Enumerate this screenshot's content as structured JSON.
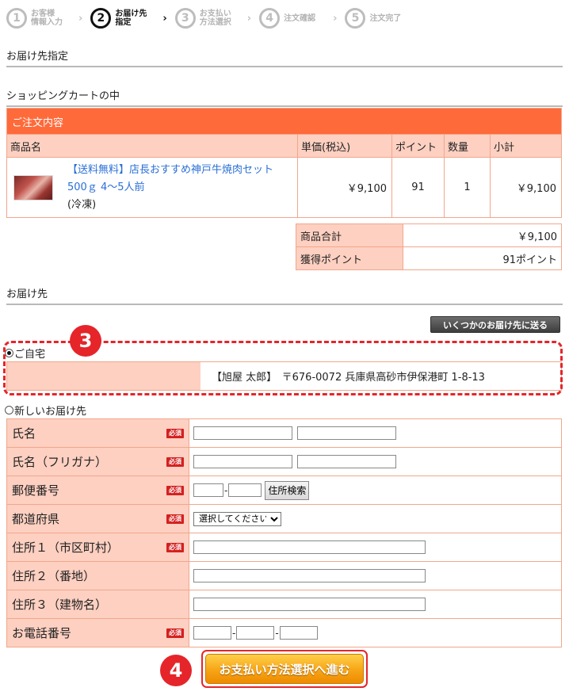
{
  "steps": [
    {
      "num": "1",
      "label": "お客様\n情報入力",
      "active": false
    },
    {
      "num": "2",
      "label": "お届け先\n指定",
      "active": true
    },
    {
      "num": "3",
      "label": "お支払い\n方法選択",
      "active": false
    },
    {
      "num": "4",
      "label": "注文確認",
      "active": false
    },
    {
      "num": "5",
      "label": "注文完了",
      "active": false
    }
  ],
  "step_arrow": "›",
  "sections": {
    "destination_spec": "お届け先指定",
    "cart": "ショッピングカートの中",
    "destination": "お届け先"
  },
  "cart": {
    "caption": "ご注文内容",
    "headers": {
      "product": "商品名",
      "unit_price": "単価(税込)",
      "points": "ポイント",
      "qty": "数量",
      "subtotal": "小計"
    },
    "item": {
      "name_line1": "【送料無料】店長おすすめ神戸牛焼肉セット",
      "name_line2": "500ｇ 4～5人前",
      "note": "(冷凍)",
      "unit_price": "￥9,100",
      "points": "91",
      "qty": "1",
      "subtotal": "￥9,100"
    },
    "totals": {
      "total_label": "商品合計",
      "total_value": "￥9,100",
      "points_label": "獲得ポイント",
      "points_value": "91ポイント"
    }
  },
  "destination": {
    "multi_button": "いくつかのお届け先に送る",
    "home_label": "ご自宅",
    "home_address": "【旭屋 太郎】　〒676-0072 兵庫県高砂市伊保港町 1-8-13",
    "new_label": "新しいお届け先",
    "required_badge": "必須"
  },
  "form": {
    "name": "氏名",
    "kana": "氏名（フリガナ）",
    "postal": "郵便番号",
    "postal_sep": "-",
    "postal_search": "住所検索",
    "prefecture": "都道府県",
    "prefecture_select": "選択してください",
    "addr1": "住所１（市区町村）",
    "addr2": "住所２（番地）",
    "addr3": "住所３（建物名）",
    "phone": "お電話番号",
    "phone_sep": "-"
  },
  "annotations": {
    "three": "3",
    "four": "4"
  },
  "submit": {
    "label": "お支払い方法選択へ進む"
  },
  "colors": {
    "accent": "#ff6a3a",
    "cell": "#fdd0c1",
    "highlight": "#e5252a"
  }
}
